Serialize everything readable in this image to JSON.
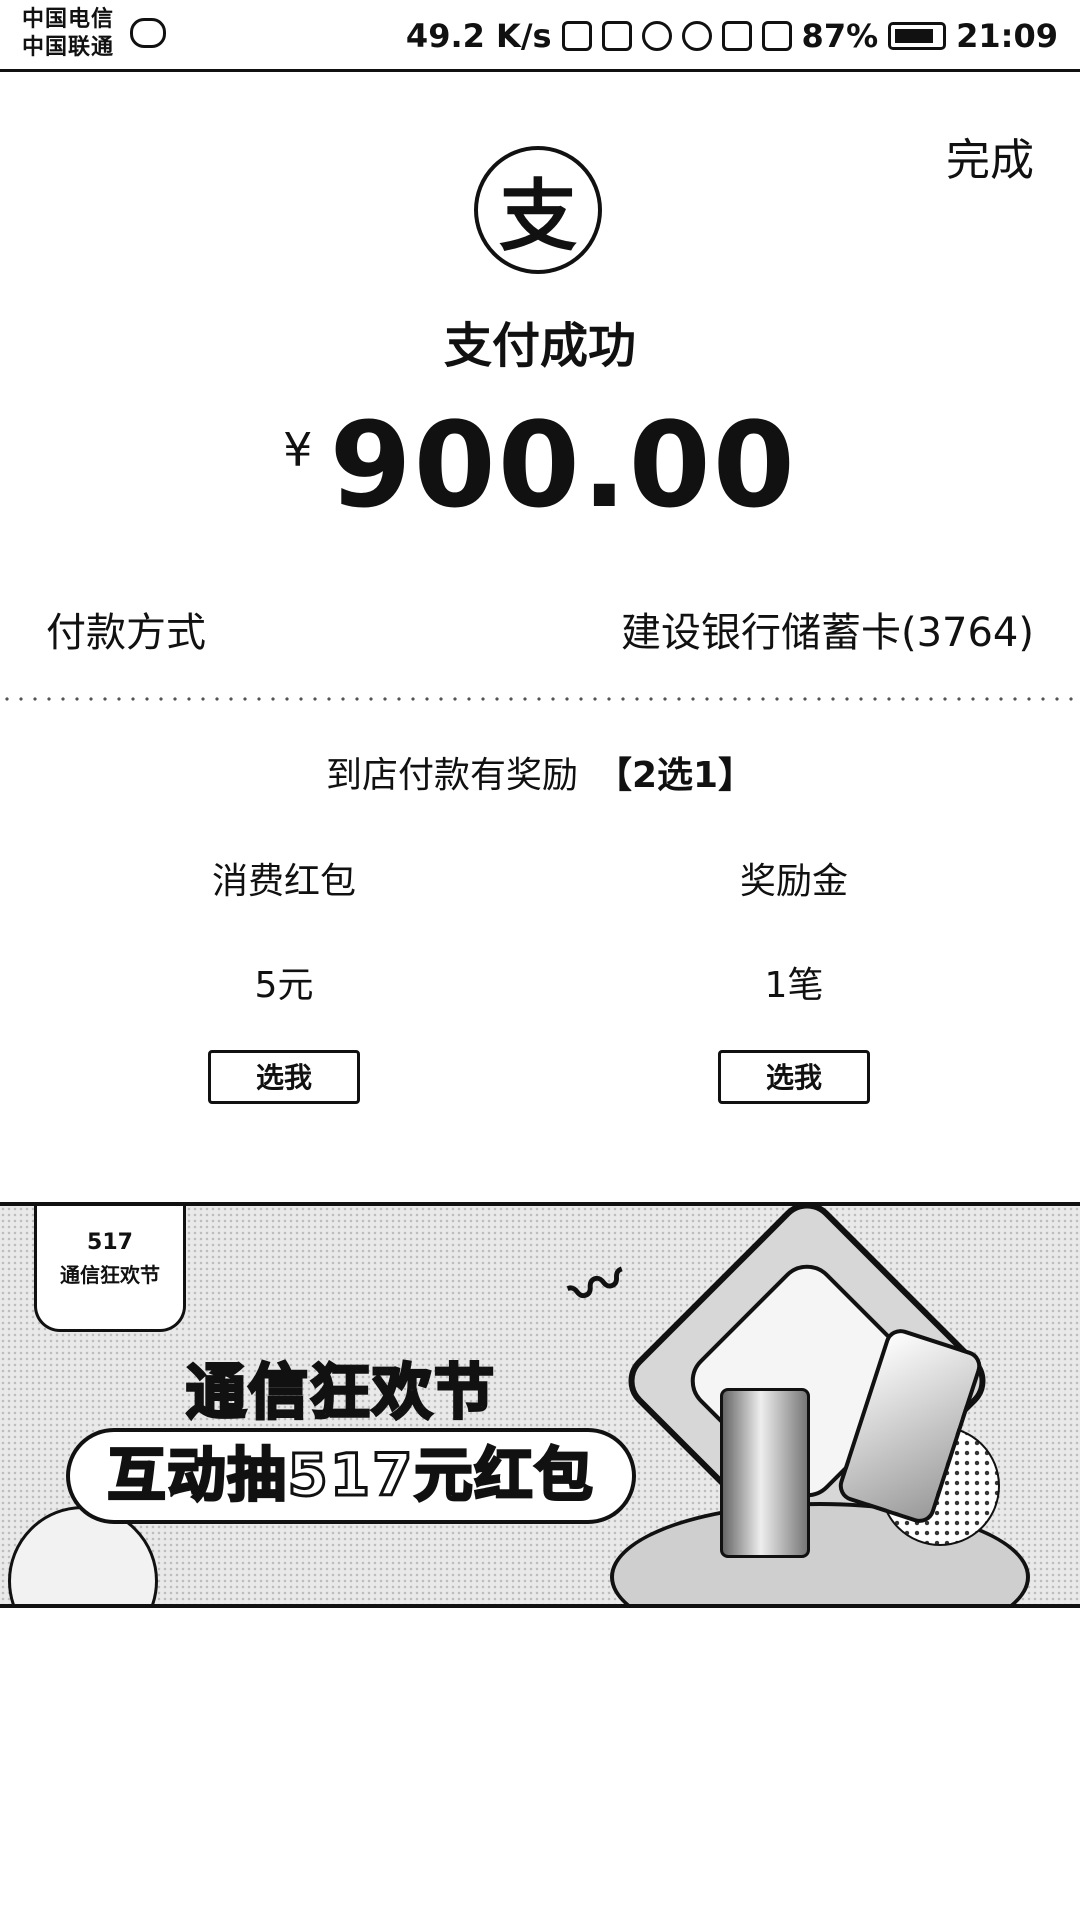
{
  "status_bar": {
    "carrier_1": "中国电信",
    "carrier_2": "中国联通",
    "speed": "49.2 K/s",
    "battery": "87%",
    "time": "21:09"
  },
  "header": {
    "done_label": "完成",
    "logo_glyph": "支"
  },
  "payment": {
    "status_title": "支付成功",
    "currency": "¥",
    "amount": "900.00",
    "method_label": "付款方式",
    "method_value": "建设银行储蓄卡(3764)"
  },
  "rewards": {
    "title": "到店付款有奖励",
    "choice": "【2选1】",
    "options": [
      {
        "name": "消费红包",
        "value": "5元",
        "button": "选我"
      },
      {
        "name": "奖励金",
        "value": "1笔",
        "button": "选我"
      }
    ]
  },
  "banner": {
    "badge_number": "517",
    "badge_name": "通信狂欢节",
    "headline": "通信狂欢节",
    "subline": "互动抽517元红包"
  }
}
